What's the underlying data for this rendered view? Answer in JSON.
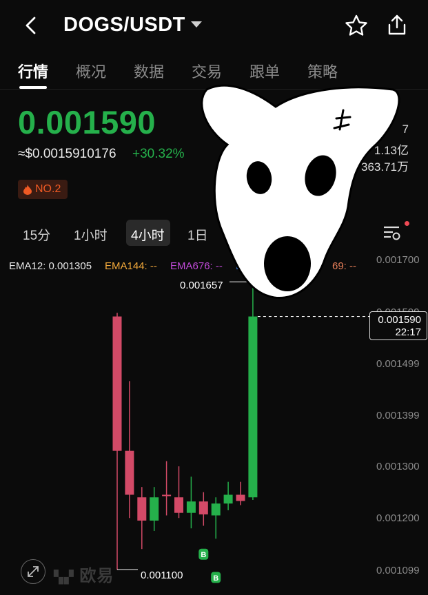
{
  "header": {
    "pair": "DOGS/USDT"
  },
  "tabs": [
    "行情",
    "概况",
    "数据",
    "交易",
    "跟单",
    "策略"
  ],
  "price": {
    "last": "0.001590",
    "usd": "≈$0.0015910176",
    "change": "+30.32%",
    "stat1": "7",
    "stat2": "1.13亿",
    "stat3": "363.71万",
    "badge": "NO.2"
  },
  "timeframes": [
    "15分",
    "1小时",
    "4小时",
    "1日"
  ],
  "active_timeframe": "4小时",
  "ema": [
    {
      "label": "EMA12: 0.001305",
      "color": "#e8e8e8"
    },
    {
      "label": "EMA144: --",
      "color": "#f2a93b"
    },
    {
      "label": "EMA676: --",
      "color": "#c04ad8"
    },
    {
      "label": "E",
      "color": "#3d7bdc"
    },
    {
      "label": "69: --",
      "color": "#e9805a"
    }
  ],
  "colors": {
    "up": "#25b04b",
    "down": "#d34a67"
  },
  "chart_data": {
    "type": "candlestick",
    "y_ticks": [
      "0.001700",
      "0.001599",
      "0.001499",
      "0.001399",
      "0.001300",
      "0.001200",
      "0.001099"
    ],
    "ylim": [
      0.00109,
      0.0017
    ],
    "current_price_label": "0.001590",
    "current_time_label": "22:17",
    "high_label": "0.001657",
    "low_label": "0.001100",
    "candles": [
      {
        "o": 0.00159,
        "h": 0.001597,
        "l": 0.0011,
        "c": 0.00133
      },
      {
        "o": 0.00133,
        "h": 0.001465,
        "l": 0.0012,
        "c": 0.001245
      },
      {
        "o": 0.00124,
        "h": 0.00126,
        "l": 0.00114,
        "c": 0.001195
      },
      {
        "o": 0.001195,
        "h": 0.00126,
        "l": 0.001175,
        "c": 0.00124
      },
      {
        "o": 0.001245,
        "h": 0.00131,
        "l": 0.001205,
        "c": 0.001243
      },
      {
        "o": 0.00124,
        "h": 0.0013,
        "l": 0.0012,
        "c": 0.00121
      },
      {
        "o": 0.00121,
        "h": 0.00128,
        "l": 0.00118,
        "c": 0.001232
      },
      {
        "o": 0.001232,
        "h": 0.00125,
        "l": 0.001185,
        "c": 0.001207
      },
      {
        "o": 0.001205,
        "h": 0.00124,
        "l": 0.00116,
        "c": 0.001228
      },
      {
        "o": 0.001228,
        "h": 0.00127,
        "l": 0.001215,
        "c": 0.001245
      },
      {
        "o": 0.001245,
        "h": 0.00127,
        "l": 0.001225,
        "c": 0.001233
      },
      {
        "o": 0.00124,
        "h": 0.001657,
        "l": 0.001235,
        "c": 0.00159
      }
    ],
    "buy_markers": [
      "B",
      "B"
    ]
  },
  "watermark": {
    "logo": "欧易"
  }
}
